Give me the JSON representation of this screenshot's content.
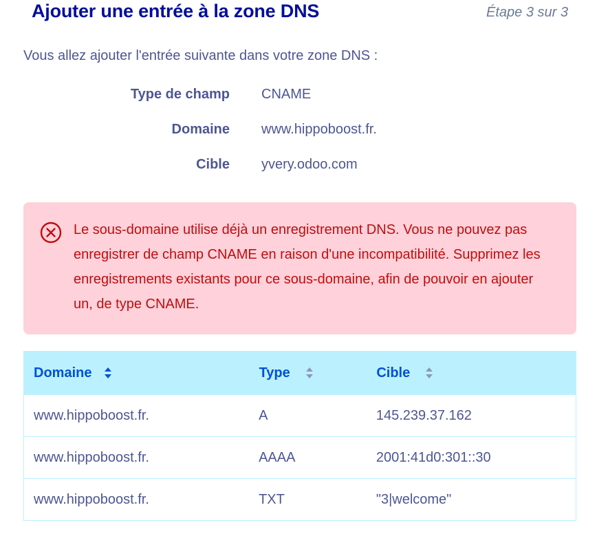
{
  "header": {
    "title": "Ajouter une entrée à la zone DNS",
    "step": "Étape 3 sur 3"
  },
  "intro": "Vous allez ajouter l'entrée suivante dans votre zone DNS :",
  "summary": [
    {
      "label": "Type de champ",
      "value": "CNAME"
    },
    {
      "label": "Domaine",
      "value": "www.hippoboost.fr."
    },
    {
      "label": "Cible",
      "value": "yvery.odoo.com"
    }
  ],
  "alert": {
    "icon": "error-circle-x-icon",
    "message": "Le sous-domaine utilise déjà un enregistrement DNS. Vous ne pouvez pas enregistrer de champ CNAME en raison d'une incompatibilité. Supprimez les enregistrements existants pour ce sous-domaine, afin de pouvoir en ajouter un, de type CNAME.",
    "color": "#be0e0e",
    "background": "#ffd1da"
  },
  "table": {
    "columns": [
      {
        "label": "Domaine",
        "sort_icon": "sort-icon"
      },
      {
        "label": "Type",
        "sort_icon": "sort-icon"
      },
      {
        "label": "Cible",
        "sort_icon": "sort-icon"
      }
    ],
    "rows": [
      {
        "domaine": "www.hippoboost.fr.",
        "type": "A",
        "cible": "145.239.37.162"
      },
      {
        "domaine": "www.hippoboost.fr.",
        "type": "AAAA",
        "cible": "2001:41d0:301::30"
      },
      {
        "domaine": "www.hippoboost.fr.",
        "type": "TXT",
        "cible": "\"3|welcome\""
      }
    ]
  },
  "colors": {
    "title": "#000e9c",
    "text": "#4d5693",
    "header_bg": "#bbf1fe",
    "header_text": "#0050d7"
  }
}
